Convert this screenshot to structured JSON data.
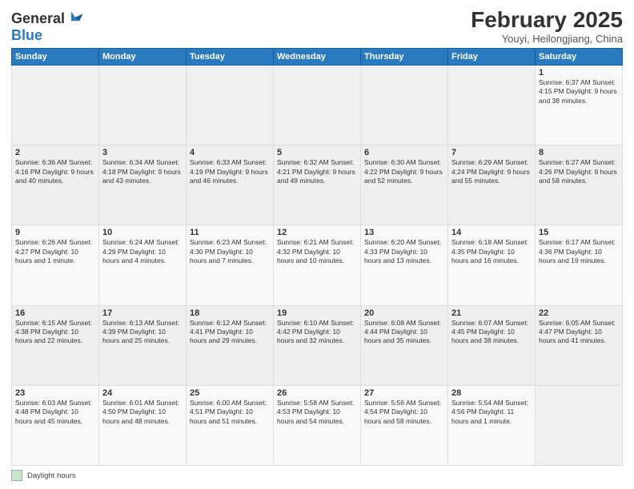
{
  "logo": {
    "general": "General",
    "blue": "Blue"
  },
  "title": "February 2025",
  "subtitle": "Youyi, Heilongjiang, China",
  "days_of_week": [
    "Sunday",
    "Monday",
    "Tuesday",
    "Wednesday",
    "Thursday",
    "Friday",
    "Saturday"
  ],
  "footer_label": "Daylight hours",
  "weeks": [
    [
      {
        "day": "",
        "info": ""
      },
      {
        "day": "",
        "info": ""
      },
      {
        "day": "",
        "info": ""
      },
      {
        "day": "",
        "info": ""
      },
      {
        "day": "",
        "info": ""
      },
      {
        "day": "",
        "info": ""
      },
      {
        "day": "1",
        "info": "Sunrise: 6:37 AM\nSunset: 4:15 PM\nDaylight: 9 hours and 38 minutes."
      }
    ],
    [
      {
        "day": "2",
        "info": "Sunrise: 6:36 AM\nSunset: 4:16 PM\nDaylight: 9 hours and 40 minutes."
      },
      {
        "day": "3",
        "info": "Sunrise: 6:34 AM\nSunset: 4:18 PM\nDaylight: 9 hours and 43 minutes."
      },
      {
        "day": "4",
        "info": "Sunrise: 6:33 AM\nSunset: 4:19 PM\nDaylight: 9 hours and 46 minutes."
      },
      {
        "day": "5",
        "info": "Sunrise: 6:32 AM\nSunset: 4:21 PM\nDaylight: 9 hours and 49 minutes."
      },
      {
        "day": "6",
        "info": "Sunrise: 6:30 AM\nSunset: 4:22 PM\nDaylight: 9 hours and 52 minutes."
      },
      {
        "day": "7",
        "info": "Sunrise: 6:29 AM\nSunset: 4:24 PM\nDaylight: 9 hours and 55 minutes."
      },
      {
        "day": "8",
        "info": "Sunrise: 6:27 AM\nSunset: 4:26 PM\nDaylight: 9 hours and 58 minutes."
      }
    ],
    [
      {
        "day": "9",
        "info": "Sunrise: 6:26 AM\nSunset: 4:27 PM\nDaylight: 10 hours and 1 minute."
      },
      {
        "day": "10",
        "info": "Sunrise: 6:24 AM\nSunset: 4:29 PM\nDaylight: 10 hours and 4 minutes."
      },
      {
        "day": "11",
        "info": "Sunrise: 6:23 AM\nSunset: 4:30 PM\nDaylight: 10 hours and 7 minutes."
      },
      {
        "day": "12",
        "info": "Sunrise: 6:21 AM\nSunset: 4:32 PM\nDaylight: 10 hours and 10 minutes."
      },
      {
        "day": "13",
        "info": "Sunrise: 6:20 AM\nSunset: 4:33 PM\nDaylight: 10 hours and 13 minutes."
      },
      {
        "day": "14",
        "info": "Sunrise: 6:18 AM\nSunset: 4:35 PM\nDaylight: 10 hours and 16 minutes."
      },
      {
        "day": "15",
        "info": "Sunrise: 6:17 AM\nSunset: 4:36 PM\nDaylight: 10 hours and 19 minutes."
      }
    ],
    [
      {
        "day": "16",
        "info": "Sunrise: 6:15 AM\nSunset: 4:38 PM\nDaylight: 10 hours and 22 minutes."
      },
      {
        "day": "17",
        "info": "Sunrise: 6:13 AM\nSunset: 4:39 PM\nDaylight: 10 hours and 25 minutes."
      },
      {
        "day": "18",
        "info": "Sunrise: 6:12 AM\nSunset: 4:41 PM\nDaylight: 10 hours and 29 minutes."
      },
      {
        "day": "19",
        "info": "Sunrise: 6:10 AM\nSunset: 4:42 PM\nDaylight: 10 hours and 32 minutes."
      },
      {
        "day": "20",
        "info": "Sunrise: 6:08 AM\nSunset: 4:44 PM\nDaylight: 10 hours and 35 minutes."
      },
      {
        "day": "21",
        "info": "Sunrise: 6:07 AM\nSunset: 4:45 PM\nDaylight: 10 hours and 38 minutes."
      },
      {
        "day": "22",
        "info": "Sunrise: 6:05 AM\nSunset: 4:47 PM\nDaylight: 10 hours and 41 minutes."
      }
    ],
    [
      {
        "day": "23",
        "info": "Sunrise: 6:03 AM\nSunset: 4:48 PM\nDaylight: 10 hours and 45 minutes."
      },
      {
        "day": "24",
        "info": "Sunrise: 6:01 AM\nSunset: 4:50 PM\nDaylight: 10 hours and 48 minutes."
      },
      {
        "day": "25",
        "info": "Sunrise: 6:00 AM\nSunset: 4:51 PM\nDaylight: 10 hours and 51 minutes."
      },
      {
        "day": "26",
        "info": "Sunrise: 5:58 AM\nSunset: 4:53 PM\nDaylight: 10 hours and 54 minutes."
      },
      {
        "day": "27",
        "info": "Sunrise: 5:56 AM\nSunset: 4:54 PM\nDaylight: 10 hours and 58 minutes."
      },
      {
        "day": "28",
        "info": "Sunrise: 5:54 AM\nSunset: 4:56 PM\nDaylight: 11 hours and 1 minute."
      },
      {
        "day": "",
        "info": ""
      }
    ]
  ]
}
